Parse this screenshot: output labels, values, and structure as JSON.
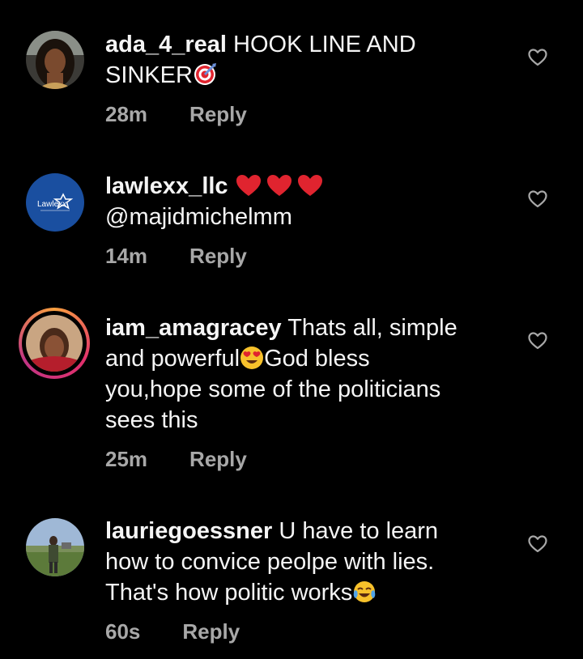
{
  "comments": [
    {
      "username": "ada_4_real",
      "text": "HOOK LINE AND SINKER",
      "emoji": "direct-hit-target-emoji",
      "time": "28m",
      "reply_label": "Reply",
      "avatar": "profile-photo-woman"
    },
    {
      "username": "lawlexx_llc",
      "emoji": "red-heart-emoji x3",
      "text": "@majidmichelmm",
      "time": "14m",
      "reply_label": "Reply",
      "avatar": "lawlexx-logo",
      "avatar_text": "Lawlexx"
    },
    {
      "username": "iam_amagracey",
      "text_line1": "Thats all, simple",
      "text_line2a": "and powerful",
      "text_line2b": "God bless",
      "text_line3": "you,hope some of the politicians",
      "text_line4": "sees this",
      "emoji": "smiling-face-with-heart-eyes-emoji",
      "time": "25m",
      "reply_label": "Reply",
      "avatar": "profile-photo-with-story-ring"
    },
    {
      "username": "lauriegoessner",
      "text_line1": "U have to learn",
      "text_line2": "how to convice peolpe with lies.",
      "text_line3": "That's how politic works",
      "emoji": "face-with-tears-of-joy-emoji",
      "time": "60s",
      "reply_label": "Reply",
      "avatar": "profile-photo-outdoors"
    }
  ],
  "colors": {
    "background": "#000000",
    "text": "#f5f5f5",
    "meta": "#a8a8a8",
    "heart_outline": "#a8a8a8",
    "red_heart": "#e0242f",
    "story_ring": "#e1306c",
    "lawlexx_blue": "#1a4fa0"
  }
}
